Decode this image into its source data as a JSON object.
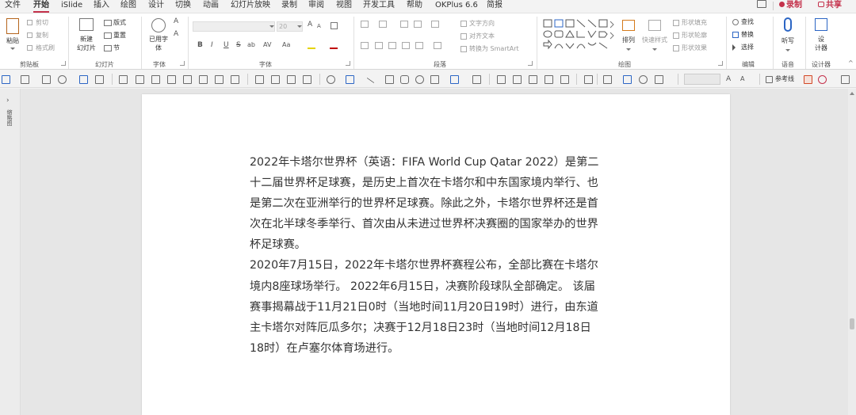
{
  "menu": {
    "tabs": [
      "文件",
      "开始",
      "iSlide",
      "插入",
      "绘图",
      "设计",
      "切换",
      "动画",
      "幻灯片放映",
      "录制",
      "审阅",
      "视图",
      "开发工具",
      "帮助",
      "OKPlus 6.6",
      "简报"
    ],
    "active_tab": "开始",
    "record_label": "录制",
    "share_label": "共享"
  },
  "ribbon": {
    "clipboard": {
      "paste": "粘贴",
      "cut": "剪切",
      "copy": "复制",
      "format_painter": "格式刷",
      "group_label": "剪贴板"
    },
    "slides": {
      "new_slide_line1": "新建",
      "new_slide_line2": "幻灯片",
      "layout": "版式",
      "reset": "重置",
      "section": "节",
      "group_label": "幻灯片"
    },
    "font_group": {
      "used_fonts_line1": "已用字",
      "used_fonts_line2": "体",
      "group_label": "字体"
    },
    "font": {
      "font_size": "20",
      "group_label": "字体",
      "bold": "B",
      "italic": "I",
      "underline": "U",
      "strike": "S",
      "shadow": "ab",
      "spacing": "AV",
      "case": "Aa",
      "grow": "A",
      "shrink": "A"
    },
    "paragraph": {
      "text_direction": "文字方向",
      "align_text": "对齐文本",
      "convert_smartart": "转换为 SmartArt",
      "group_label": "段落"
    },
    "drawing": {
      "arrange": "排列",
      "quick_styles": "快速样式",
      "shape_fill": "形状填充",
      "shape_outline": "形状轮廓",
      "shape_effects": "形状效果",
      "group_label": "绘图"
    },
    "editing": {
      "find": "查找",
      "replace": "替换",
      "select": "选择",
      "group_label": "编辑"
    },
    "voice": {
      "dictate": "听写",
      "group_label": "语音"
    },
    "designer": {
      "designer_line1": "设",
      "designer_line2": "计器",
      "group_label": "设计器"
    }
  },
  "qat": {
    "guides_label": "参考线"
  },
  "thumbnail_pane": {
    "toggle_glyph": "›",
    "label": "缩略图"
  },
  "slide": {
    "lines": [
      "2022年卡塔尔世界杯（英语：FIFA World Cup Qatar 2022）是第二",
      "十二届世界杯足球赛，是历史上首次在卡塔尔和中东国家境内举行、也",
      "是第二次在亚洲举行的世界杯足球赛。除此之外，卡塔尔世界杯还是首",
      "次在北半球冬季举行、首次由从未进过世界杯决赛圈的国家举办的世界",
      "杯足球赛。",
      "2020年7月15日，2022年卡塔尔世界杯赛程公布，全部比赛在卡塔尔",
      "境内8座球场举行。 2022年6月15日，决赛阶段球队全部确定。 该届",
      "赛事揭幕战于11月21日0时（当地时间11月20日19时）进行，由东道",
      "主卡塔尔对阵厄瓜多尔；决赛于12月18日23时（当地时间12月18日",
      "18时）在卢塞尔体育场进行。"
    ]
  },
  "colors": {
    "accent": "#c4314b",
    "ribbon_bg": "#ffffff",
    "app_bg": "#f3f3f3",
    "canvas_bg": "#e6e6e6",
    "text": "#333333"
  }
}
